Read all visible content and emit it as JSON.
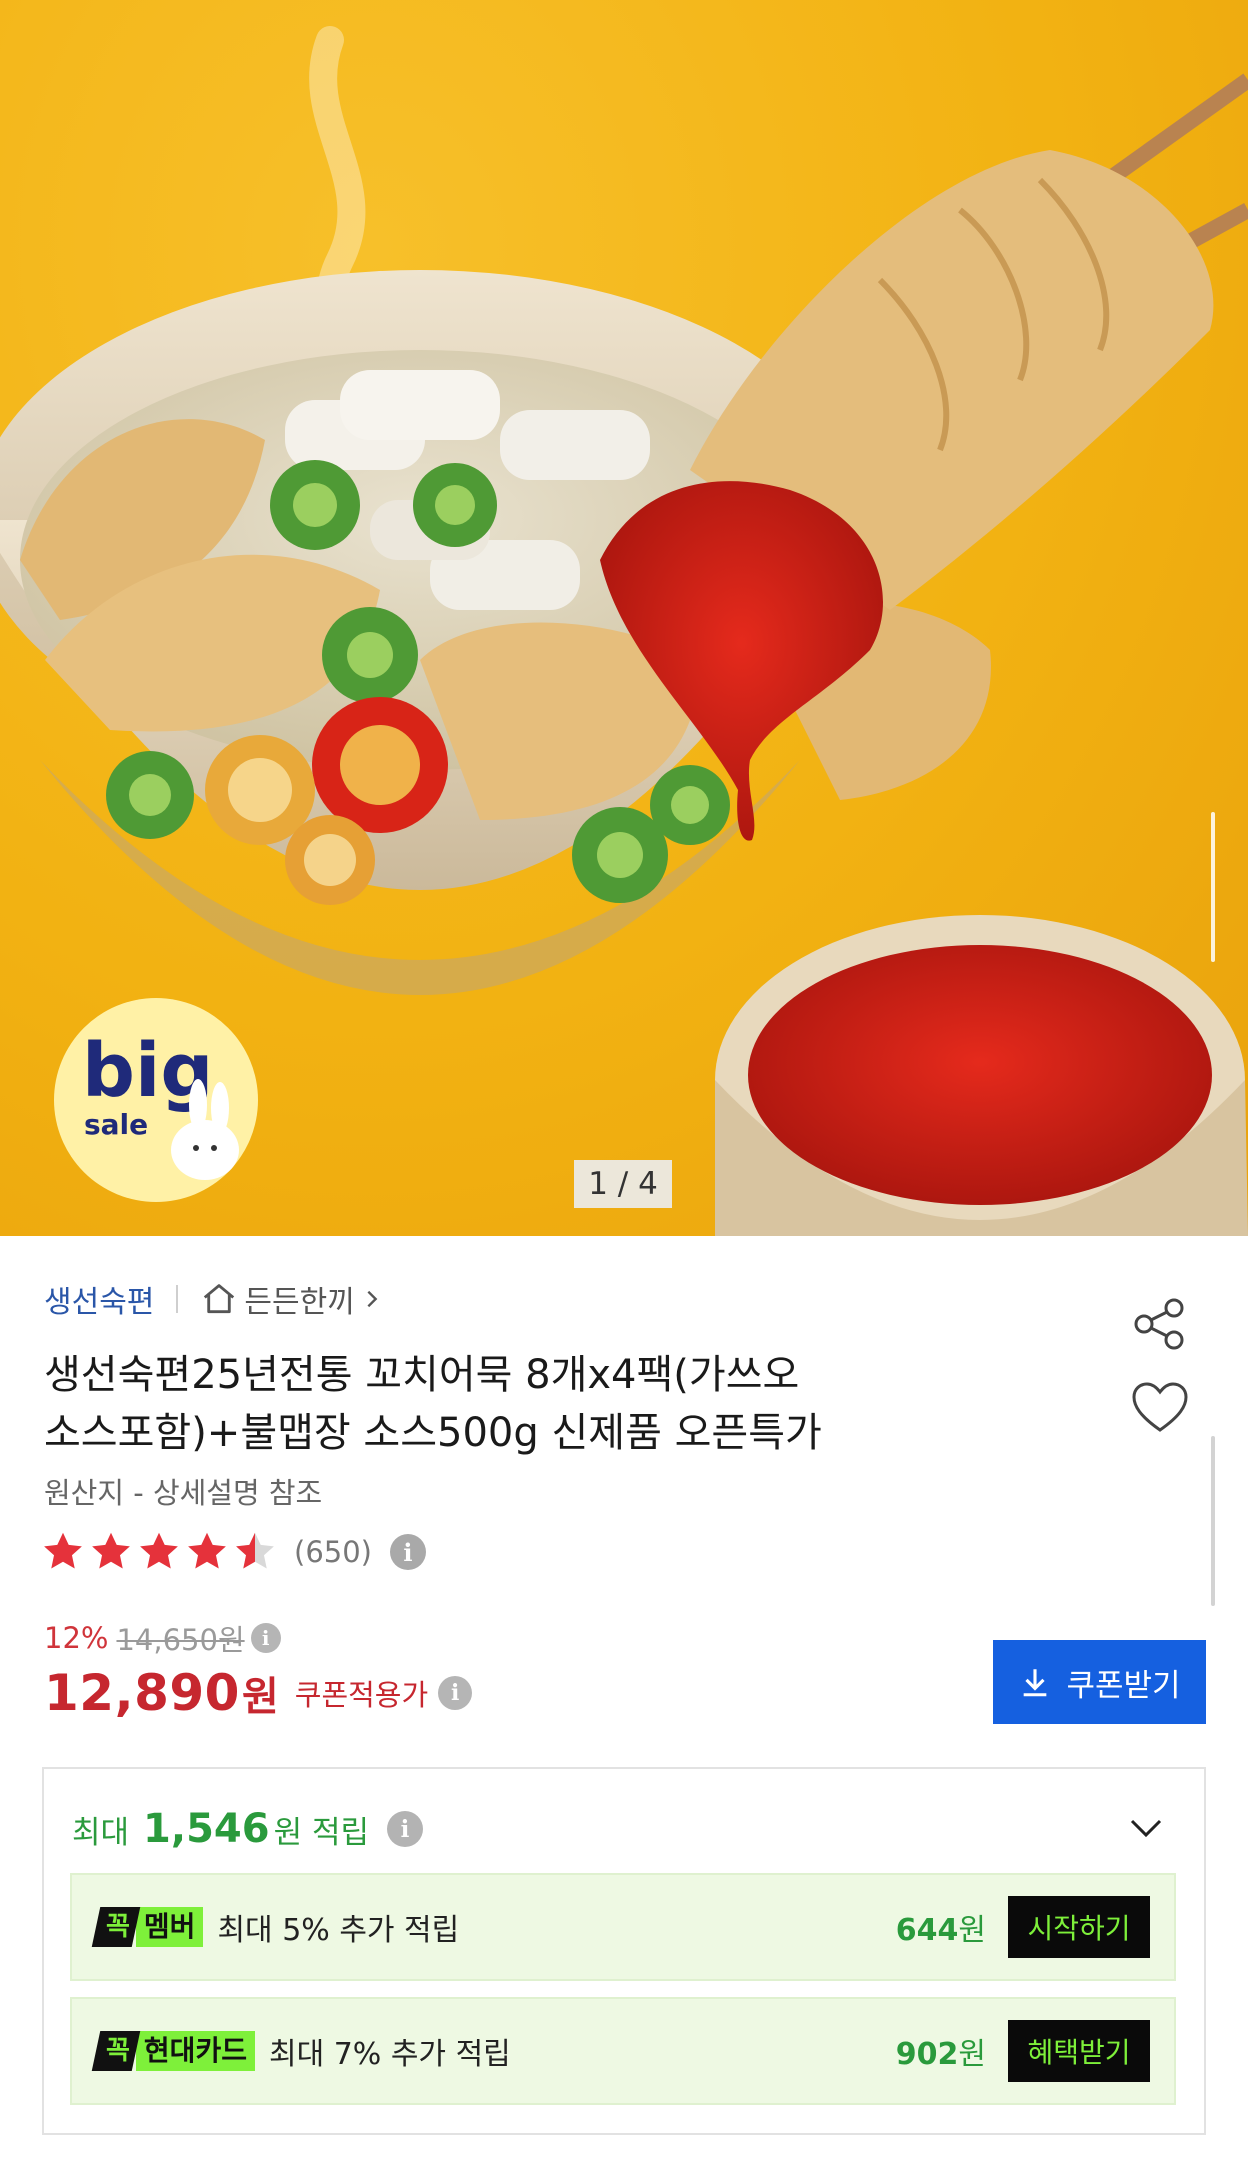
{
  "hero": {
    "counter": "1 / 4",
    "sale_badge": {
      "big": "big",
      "sale": "sale"
    }
  },
  "product": {
    "brand": "생선숙편",
    "category": "든든한끼",
    "title_line1": "생선숙편25년전통 꼬치어묵 8개x4팩(가쓰오",
    "title_line2": "소스포함)+불맵장 소스500g 신제품 오픈특가",
    "origin": "원산지 - 상세설명 참조",
    "rating": 4.5,
    "review_count": "(650)"
  },
  "price": {
    "discount": "12%",
    "original": "14,650원",
    "current": "12,890",
    "current_unit": "원",
    "label": "쿠폰적용가",
    "coupon_button": "쿠폰받기"
  },
  "points": {
    "prefix": "최대",
    "amount": "1,546",
    "suffix": "원 적립",
    "benefits": [
      {
        "badge_k": "꼭",
        "badge_name": "멤버",
        "text": "최대 5% 추가 적립",
        "amount": "644",
        "unit": "원",
        "button": "시작하기"
      },
      {
        "badge_k": "꼭",
        "badge_name": "현대카드",
        "text": "최대 7% 추가 적립",
        "amount": "902",
        "unit": "원",
        "button": "혜택받기"
      }
    ]
  },
  "colors": {
    "brand": "#2a56a8",
    "price_red": "#c6272f",
    "coupon_blue": "#1560e0",
    "points_green": "#2a9a3c",
    "badge_lime": "#7ef03a",
    "hero_yellow": "#f2b212"
  },
  "icons": [
    "home-icon",
    "chevron-right-icon",
    "share-icon",
    "heart-icon",
    "star-icon",
    "info-icon",
    "download-icon",
    "chevron-down-icon"
  ]
}
